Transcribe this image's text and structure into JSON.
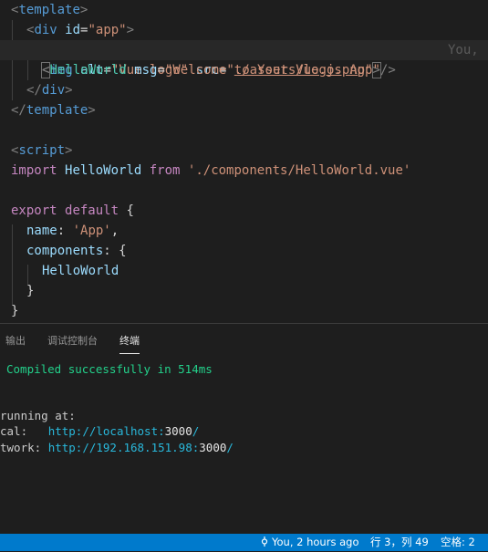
{
  "editor": {
    "lines": [
      {
        "t1": "<",
        "t2": "template",
        "t3": ">"
      },
      {
        "t1": "<",
        "t2": "div",
        "a1": "id",
        "eq": "=",
        "v1": "\"app\"",
        "t3": ">"
      },
      {
        "t1": "<",
        "t2": "img",
        "a1": "alt",
        "v1": "\"Vue logo\"",
        "a2": "src",
        "v2q1": "\"",
        "v2": "./assets/logo.png",
        "v2q2": "\"",
        "t3": ">",
        "ghost": "You,"
      },
      {
        "t1": "<",
        "t2": "HelloWorld",
        "a1": "msg",
        "v1": "\"Welcome to Your Vue.js App\"",
        "t3": "/>"
      },
      {
        "t1": "</",
        "t2": "div",
        "t3": ">"
      },
      {
        "t1": "</",
        "t2": "template",
        "t3": ">"
      },
      {
        "t1": "<",
        "t2": "script",
        "t3": ">"
      },
      {
        "k1": "import",
        "id": "HelloWorld",
        "k2": "from",
        "s": "'./components/HelloWorld.vue'"
      },
      {
        "k1": "export",
        "k2": "default",
        "b": "{"
      },
      {
        "p": "name",
        "c": ":",
        "s": "'App'",
        "e": ","
      },
      {
        "p": "components",
        "c": ":",
        "b": "{"
      },
      {
        "id": "HelloWorld"
      },
      {
        "b": "}"
      },
      {
        "b": "}"
      }
    ]
  },
  "panel": {
    "tabs": [
      {
        "label": "输出"
      },
      {
        "label": "调试控制台"
      },
      {
        "label": "终端"
      }
    ],
    "terminal": {
      "compiled": "Compiled successfully in 514ms",
      "running": "running at:",
      "local_label": "cal:   ",
      "local_url_a": "http://localhost:",
      "local_url_b": "3000",
      "local_url_c": "/",
      "network_label": "twork: ",
      "network_url_a": "http://192.168.151.98:",
      "network_url_b": "3000",
      "network_url_c": "/"
    }
  },
  "statusbar": {
    "blame": "You, 2 hours ago",
    "position": "行 3，列 49",
    "spaces": "空格: 2",
    "color": "#007acc"
  }
}
